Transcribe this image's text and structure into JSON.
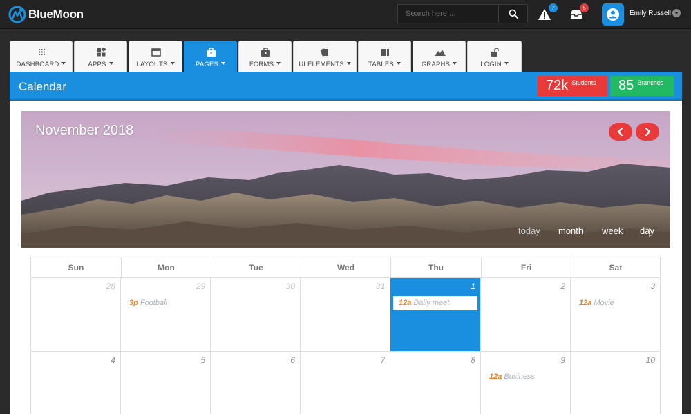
{
  "app": {
    "brand": "BlueMoon"
  },
  "header": {
    "search_placeholder": "Search here ...",
    "alerts_count": "7",
    "inbox_count": "5",
    "user_name": "Emily Russell"
  },
  "nav": {
    "tabs": [
      {
        "label": "DASHBOARD",
        "icon": "dashboard-icon"
      },
      {
        "label": "APPS",
        "icon": "apps-grid-icon"
      },
      {
        "label": "LAYOUTS",
        "icon": "layout-window-icon"
      },
      {
        "label": "PAGES",
        "icon": "briefcase-icon"
      },
      {
        "label": "FORMS",
        "icon": "briefcase-icon"
      },
      {
        "label": "UI ELEMENTS",
        "icon": "cards-icon"
      },
      {
        "label": "TABLES",
        "icon": "columns-icon"
      },
      {
        "label": "GRAPHS",
        "icon": "mountain-chart-icon"
      },
      {
        "label": "LOGIN",
        "icon": "unlock-icon"
      }
    ],
    "active": "PAGES"
  },
  "page": {
    "title": "Calendar",
    "stats": [
      {
        "value": "72k",
        "label": "Students",
        "color": "#e83a3a"
      },
      {
        "value": "85",
        "label": "Branches",
        "color": "#21ba62"
      }
    ]
  },
  "calendar": {
    "month_title": "November 2018",
    "views": {
      "today": "today",
      "month": "month",
      "week": "week",
      "day": "day"
    },
    "weekdays": [
      "Sun",
      "Mon",
      "Tue",
      "Wed",
      "Thu",
      "Fri",
      "Sat"
    ],
    "week1": [
      "28",
      "29",
      "30",
      "31",
      "1",
      "2",
      "3"
    ],
    "week2": [
      "4",
      "5",
      "6",
      "7",
      "8",
      "9",
      "10"
    ],
    "events": {
      "football": {
        "time": "3p",
        "title": "Football"
      },
      "daily_meet": {
        "time": "12a",
        "title": "Daily meet"
      },
      "movie": {
        "time": "12a",
        "title": "Movie"
      },
      "business": {
        "time": "12a",
        "title": "Business"
      }
    },
    "accent": "#1a8fe0",
    "event_time_color": "#f07f20"
  }
}
